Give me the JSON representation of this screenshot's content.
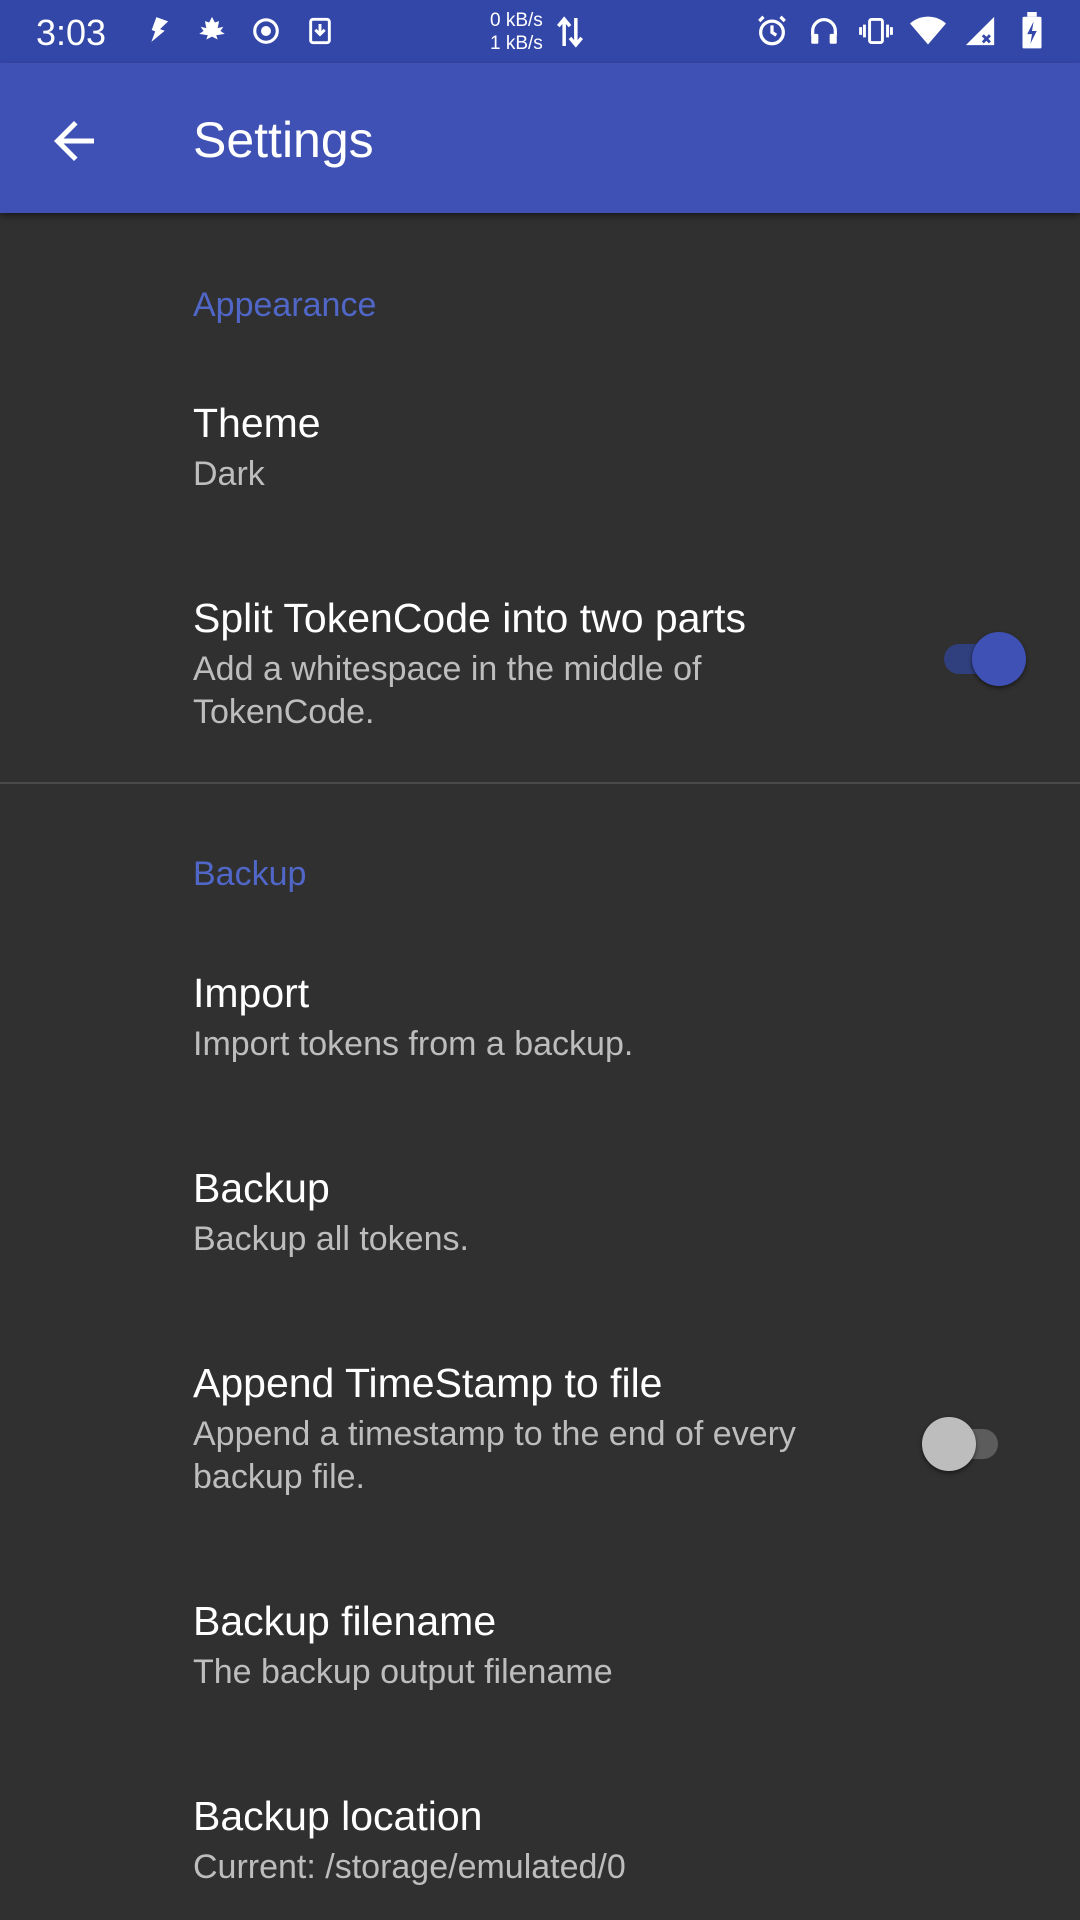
{
  "status_bar": {
    "time": "3:03",
    "net_up": "0 kB/s",
    "net_down": "1 kB/s",
    "icons_left": [
      "flash-icon",
      "maple-leaf-icon",
      "record-icon",
      "download-icon"
    ],
    "icons_right": [
      "alarm-icon",
      "headset-icon",
      "vibrate-icon",
      "wifi-icon",
      "signal-icon",
      "battery-charging-icon"
    ]
  },
  "app_bar": {
    "title": "Settings",
    "back_icon": "arrow-back-icon"
  },
  "sections": {
    "appearance": {
      "header": "Appearance",
      "theme": {
        "title": "Theme",
        "summary": "Dark"
      },
      "split": {
        "title": "Split TokenCode into two parts",
        "summary": "Add a whitespace in the middle of TokenCode.",
        "enabled": true
      }
    },
    "backup": {
      "header": "Backup",
      "import": {
        "title": "Import",
        "summary": "Import tokens from a backup."
      },
      "backup": {
        "title": "Backup",
        "summary": "Backup all tokens."
      },
      "timestamp": {
        "title": "Append TimeStamp to file",
        "summary": "Append a timestamp to the end of every backup file.",
        "enabled": false
      },
      "filename": {
        "title": "Backup filename",
        "summary": "The backup output filename"
      },
      "location": {
        "title": "Backup location",
        "summary": "Current: /storage/emulated/0"
      }
    }
  },
  "colors": {
    "primary": "#3f51b5",
    "primary_dark": "#3347a8",
    "background": "#303030",
    "accent_text": "#5067c8"
  }
}
